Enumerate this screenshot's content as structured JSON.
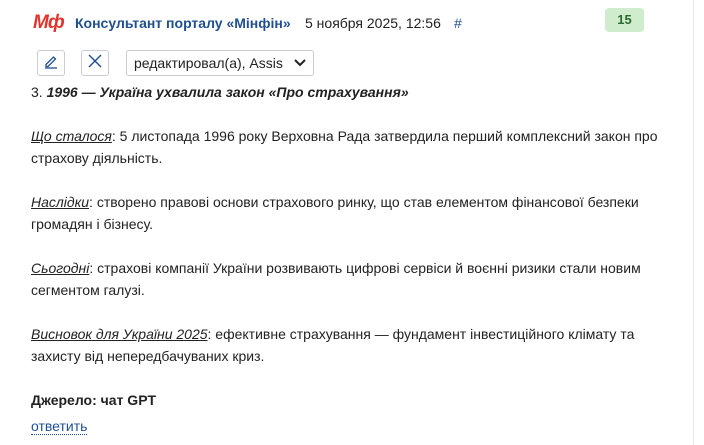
{
  "header": {
    "logo_text": "Мф",
    "author": "Консультант порталу «Мінфін»",
    "date": "5 ноября 2025, 12:56",
    "hash": "#",
    "score": "15"
  },
  "toolbar": {
    "edit_icon": "pencil-icon",
    "close_icon": "close-icon",
    "select_value": "редактировал(а), Assis",
    "select_icon": "chevron-down-icon"
  },
  "post": {
    "heading_num": "3.",
    "heading": "1996 — Україна ухвалила закон «Про страхування»",
    "paragraphs": [
      {
        "label": "Що сталося",
        "text": ": 5 листопада 1996 року Верховна Рада затвердила перший комплексний закон про страхову діяльність."
      },
      {
        "label": "Наслідки",
        "text": ": створено правові основи страхового ринку, що став елементом фінансової безпеки громадян і бізнесу."
      },
      {
        "label": "Сьогодні",
        "text": ": страхові компанії України розвивають цифрові сервіси й воєнні ризики стали новим сегментом галузі."
      },
      {
        "label": "Висновок для України 2025",
        "text": ": ефективне страхування — фундамент інвестиційного клімату та захисту від непередбачуваних криз."
      }
    ],
    "source": "Джерело: чат GPT",
    "reply": "ответить"
  },
  "colors": {
    "brand_red": "#e0342c",
    "link_blue": "#1f4f91",
    "score_bg": "#cfeccd"
  }
}
